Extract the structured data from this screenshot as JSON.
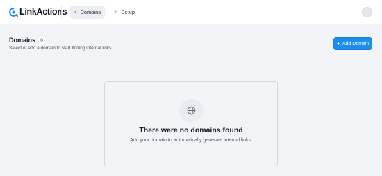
{
  "app": {
    "brand": "LinkActions",
    "brand_color": "#1d8ef0"
  },
  "nav": {
    "items": [
      {
        "label": "Domains",
        "icon": "globe-icon",
        "active": true
      },
      {
        "label": "Setup",
        "icon": "sparkles-icon",
        "active": false
      }
    ]
  },
  "user": {
    "avatar_initial": "T"
  },
  "page": {
    "title": "Domains",
    "count": "0",
    "subtitle": "Select or add a domain to start finding internal links",
    "add_button_label": "Add Domain",
    "add_button_icon": "plus-icon"
  },
  "empty_state": {
    "icon": "globe-icon",
    "title": "There were no domains found",
    "description": "Add your domain to automatically generate internal links."
  }
}
